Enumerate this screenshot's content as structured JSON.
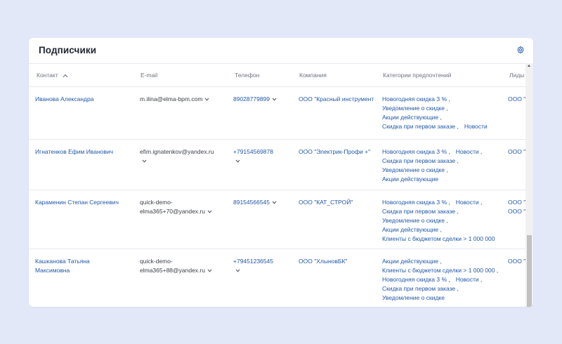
{
  "card": {
    "title": "Подписчики"
  },
  "columns": {
    "contact": "Контакт",
    "email": "E-mail",
    "phone": "Телефон",
    "company": "Компания",
    "categories": "Категории предпочтений",
    "leads": "Лиды"
  },
  "rows": [
    {
      "contact": [
        "Иванова Александра"
      ],
      "email": [
        "m.ilina@elma-bpm.com"
      ],
      "phone": "89028779899",
      "company": "ООО \"Красный инструмент",
      "categories": [
        [
          "Новогодняя скидка 3 %"
        ],
        [
          "Уведомление о скидке"
        ],
        [
          "Акции действующие"
        ],
        [
          "Скидка при первом заказе",
          "Новости"
        ]
      ],
      "leads": [
        "ООО \""
      ]
    },
    {
      "contact": [
        "Игнатенков Ефим Иванович"
      ],
      "email": [
        "efim.ignatenkov@yandex.ru"
      ],
      "phone": "+79154569878",
      "company": "ООО \"Электрик-Профи +\"",
      "categories": [
        [
          "Новогодняя скидка 3 %",
          "Новости"
        ],
        [
          "Скидка при первом заказе"
        ],
        [
          "Уведомление о скидке"
        ],
        [
          "Акции действующие"
        ]
      ],
      "leads": [
        "ООО \""
      ]
    },
    {
      "contact": [
        "Караменин Степан Сергеевич"
      ],
      "email": [
        "quick-demo-",
        "elma365+70@yandex.ru"
      ],
      "phone": "89154566545",
      "company": "ООО \"КАТ_СТРОЙ\"",
      "categories": [
        [
          "Новогодняя скидка 3 %",
          "Новости"
        ],
        [
          "Скидка при первом заказе"
        ],
        [
          "Уведомление о скидке"
        ],
        [
          "Акции действующие"
        ],
        [
          "Клиенты с бюджетом сделки > 1 000 000"
        ]
      ],
      "leads": [
        "ООО \"",
        "ООО \""
      ]
    },
    {
      "contact": [
        "Кашканова Татьяна",
        "Максимовна"
      ],
      "email": [
        "quick-demo-",
        "elma365+88@yandex.ru"
      ],
      "phone": "+79451236545",
      "company": "ООО \"ХлыновБК\"",
      "categories": [
        [
          "Акции действующие"
        ],
        [
          "Клиенты с бюджетом сделки > 1 000 000"
        ],
        [
          "Новогодняя скидка 3 %",
          "Новости"
        ],
        [
          "Скидка при первом заказе"
        ],
        [
          "Уведомление о скидке"
        ]
      ],
      "leads": [
        "ООО \""
      ]
    }
  ],
  "colors": {
    "background": "#e2e8f8",
    "link": "#2258a8",
    "header_text": "#6d7480"
  }
}
